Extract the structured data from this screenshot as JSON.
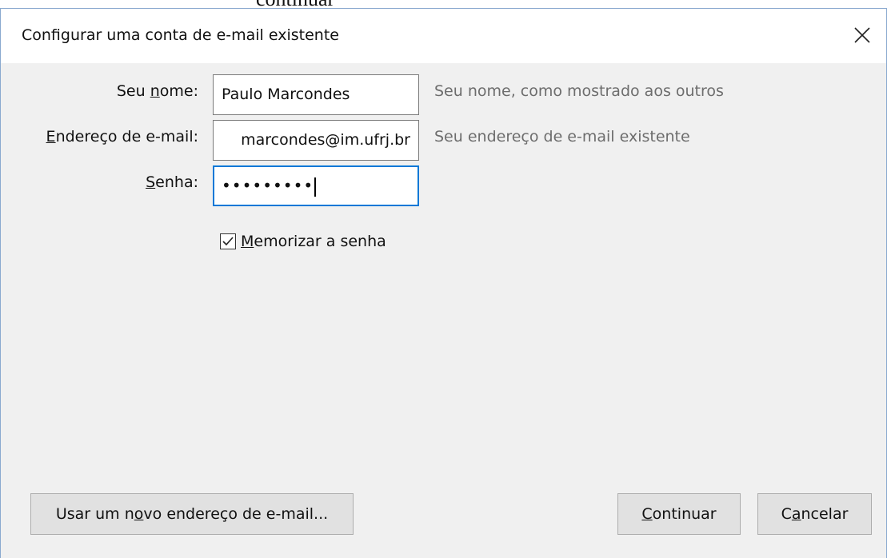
{
  "background_fragment": "continuar",
  "dialog": {
    "title": "Configurar uma conta de e-mail existente",
    "close_icon": "close-icon"
  },
  "form": {
    "name": {
      "label_pre": "Seu ",
      "label_key": "n",
      "label_post": "ome:",
      "value": "Paulo Marcondes",
      "hint": "Seu nome, como mostrado aos outros"
    },
    "email": {
      "label_key": "E",
      "label_post": "ndereço de e-mail:",
      "value": "marcondes@im.ufrj.br",
      "hint": "Seu endereço de e-mail existente"
    },
    "password": {
      "label_key": "S",
      "label_post": "enha:",
      "value_masked": "•••••••••"
    },
    "remember": {
      "checked": true,
      "label_key": "M",
      "label_post": "emorizar a senha"
    }
  },
  "buttons": {
    "new_address": {
      "pre": "Usar um n",
      "key": "o",
      "post": "vo endereço de e-mail..."
    },
    "continue": {
      "key": "C",
      "post": "ontinuar"
    },
    "cancel": {
      "pre": "C",
      "key": "a",
      "post": "ncelar"
    }
  },
  "colors": {
    "focus_border": "#0078d7",
    "hint_text": "#6d6d6d",
    "dialog_bg": "#f0f0f0"
  }
}
